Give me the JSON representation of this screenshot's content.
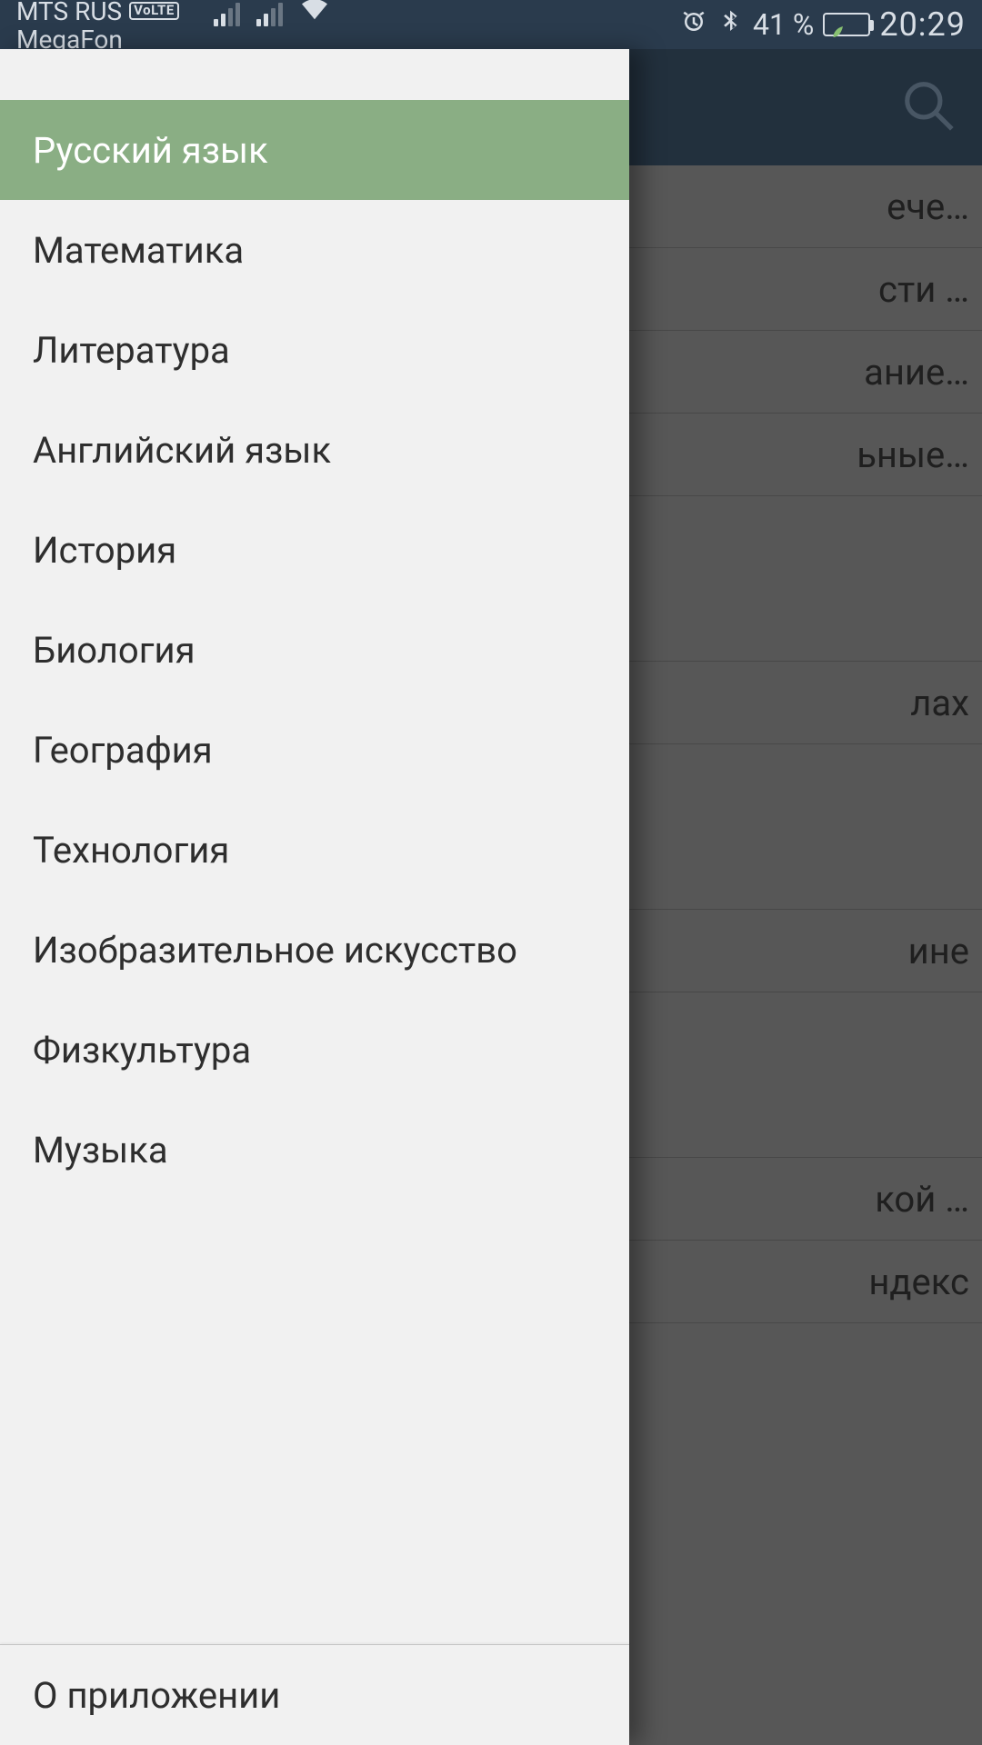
{
  "status": {
    "carrier1": "MTS RUS",
    "volte": "VoLTE",
    "carrier2": "MegaFon",
    "battery_percent": "41 %",
    "time": "20:29"
  },
  "drawer": {
    "items": [
      {
        "label": "Русский язык",
        "selected": true
      },
      {
        "label": "Математика",
        "selected": false
      },
      {
        "label": "Литература",
        "selected": false
      },
      {
        "label": "Английский язык",
        "selected": false
      },
      {
        "label": "История",
        "selected": false
      },
      {
        "label": "Биология",
        "selected": false
      },
      {
        "label": "География",
        "selected": false
      },
      {
        "label": "Технология",
        "selected": false
      },
      {
        "label": "Изобразительное искусство",
        "selected": false
      },
      {
        "label": "Физкультура",
        "selected": false
      },
      {
        "label": "Музыка",
        "selected": false
      }
    ],
    "footer": "О приложении"
  },
  "background_rows": [
    {
      "text": "ече…",
      "tall": false
    },
    {
      "text": "сти …",
      "tall": false
    },
    {
      "text": "ание…",
      "tall": false
    },
    {
      "text": "ьные…",
      "tall": false
    },
    {
      "text": "",
      "tall": true
    },
    {
      "text": "лах",
      "tall": false
    },
    {
      "text": "",
      "tall": true
    },
    {
      "text": "ине",
      "tall": false
    },
    {
      "text": "",
      "tall": true
    },
    {
      "text": "кой …",
      "tall": false
    },
    {
      "text": "ндекс",
      "tall": false
    }
  ]
}
